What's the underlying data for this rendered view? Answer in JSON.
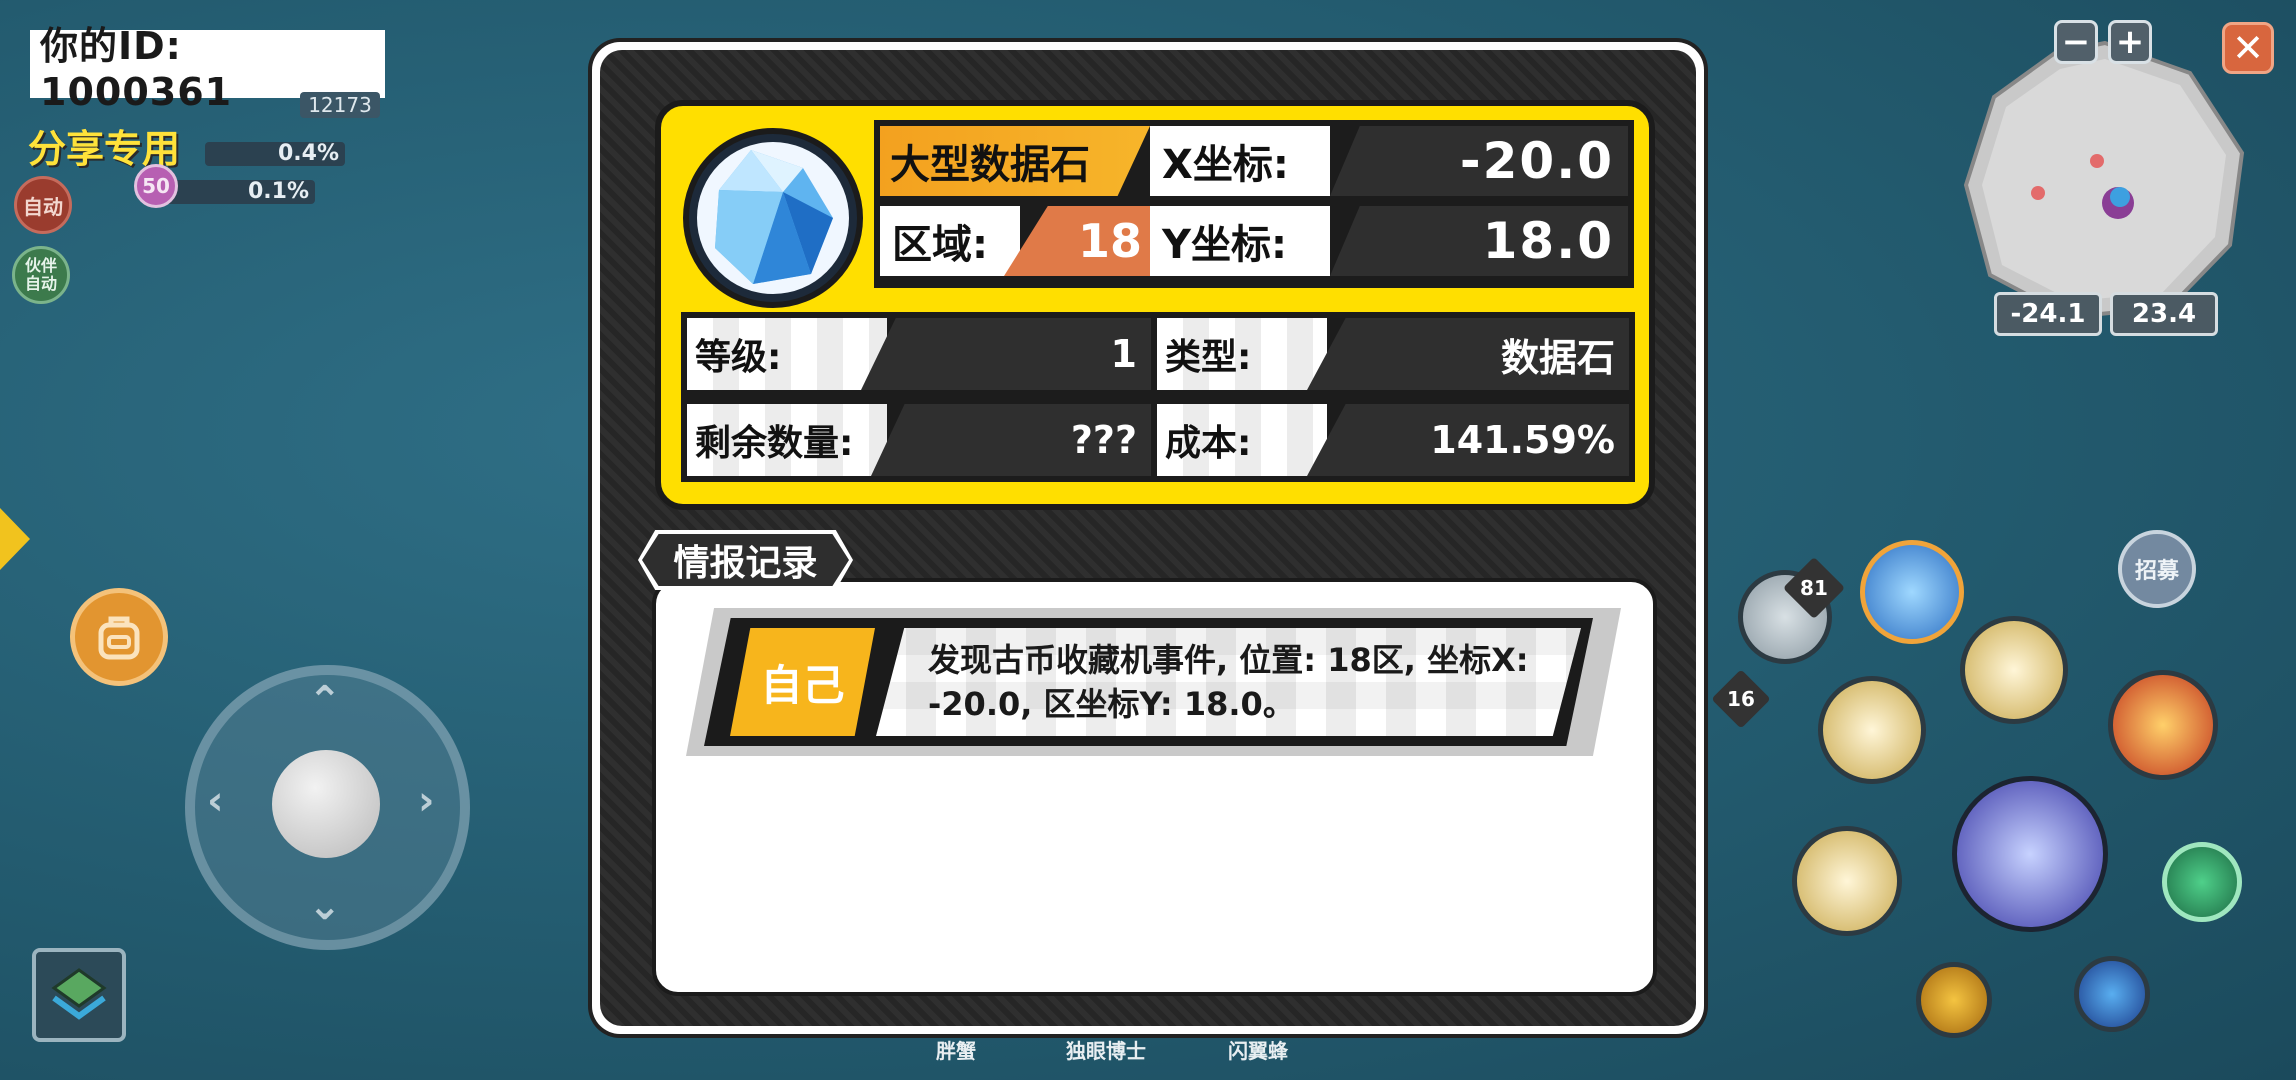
{
  "hud": {
    "player_id": "你的ID: 1000361",
    "share_label": "分享专用",
    "level_small": "12173",
    "stat_rows": [
      {
        "badge": "",
        "value": "0.4%"
      },
      {
        "badge": "50",
        "value": "0.1%"
      }
    ],
    "auto_label": "自动",
    "partner_auto_label": "伙伴自动"
  },
  "minimap": {
    "x_readout": "-24.1",
    "y_readout": "23.4",
    "zoom_out": "−",
    "zoom_in": "+",
    "close": "✕"
  },
  "skills": {
    "potion_count_1": "81",
    "potion_count_2": "16",
    "recruit_label": "招募"
  },
  "bottom_names": [
    "胖蟹",
    "独眼博士",
    "闪翼蜂"
  ],
  "modal": {
    "item_name": "大型数据石",
    "x_label": "X坐标:",
    "x_value": "-20.0",
    "zone_label": "区域:",
    "zone_value": "18",
    "y_label": "Y坐标:",
    "y_value": "18.0",
    "stats": {
      "level_label": "等级:",
      "level_value": "1",
      "type_label": "类型:",
      "type_value": "数据石",
      "remaining_label": "剩余数量:",
      "remaining_value": "???",
      "cost_label": "成本:",
      "cost_value": "141.59%"
    },
    "intel_tab": "情报记录",
    "records": [
      {
        "source": "自己",
        "text": "发现古币收藏机事件, 位置: 18区, 坐标X: -20.0, 区坐标Y: 18.0。"
      }
    ]
  },
  "colors": {
    "card_yellow": "#ffdf00",
    "name_orange": "#f3a11f",
    "zone_orange": "#e07a48",
    "self_tag": "#f7b51c"
  }
}
